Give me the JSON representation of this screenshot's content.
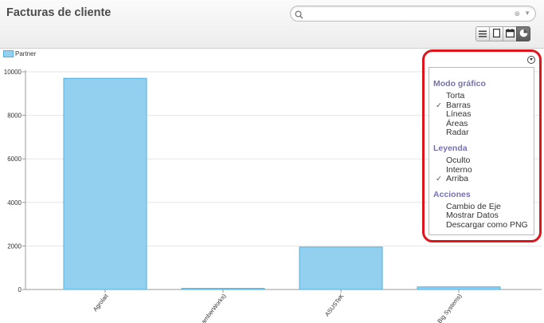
{
  "header": {
    "title": "Facturas de cliente",
    "search": {
      "value": "",
      "placeholder": ""
    }
  },
  "view_switcher": {
    "buttons": [
      {
        "name": "list-view-icon",
        "active": false
      },
      {
        "name": "form-view-icon",
        "active": false
      },
      {
        "name": "calendar-view-icon",
        "active": false
      },
      {
        "name": "graph-view-icon",
        "active": true
      }
    ]
  },
  "chart_data": {
    "type": "bar",
    "categories": [
      "Agrolait",
      "Camptocamp (ChamberWorks)",
      "ASUSTeK",
      "China Export (Big Systems)"
    ],
    "visible_category_labels": [
      "Agrolait",
      "amberWorks)",
      "ASUSTeK",
      "Big Systems)"
    ],
    "series": [
      {
        "name": "Partner",
        "values": [
          9700,
          50,
          1950,
          120
        ]
      }
    ],
    "y_ticks": [
      0,
      2000,
      4000,
      6000,
      8000,
      10000
    ],
    "ylim": [
      0,
      10500
    ],
    "grid": true,
    "legend_position": "top-left",
    "bar_color": "#93d0ef",
    "bar_border_color": "#4fb0de"
  },
  "chart_menu": {
    "sections": [
      {
        "title": "Modo gráfico",
        "items": [
          {
            "label": "Torta",
            "checked": false
          },
          {
            "label": "Barras",
            "checked": true
          },
          {
            "label": "Líneas",
            "checked": false
          },
          {
            "label": "Áreas",
            "checked": false
          },
          {
            "label": "Radar",
            "checked": false
          }
        ]
      },
      {
        "title": "Leyenda",
        "items": [
          {
            "label": "Oculto",
            "checked": false
          },
          {
            "label": "Interno",
            "checked": false
          },
          {
            "label": "Arriba",
            "checked": true
          }
        ]
      },
      {
        "title": "Acciones",
        "items": [
          {
            "label": "Cambio de Eje",
            "checked": false
          },
          {
            "label": "Mostrar Datos",
            "checked": false
          },
          {
            "label": "Descargar como PNG",
            "checked": false
          }
        ]
      }
    ],
    "check_mark": "✓",
    "highlight_color": "#e0141c"
  }
}
